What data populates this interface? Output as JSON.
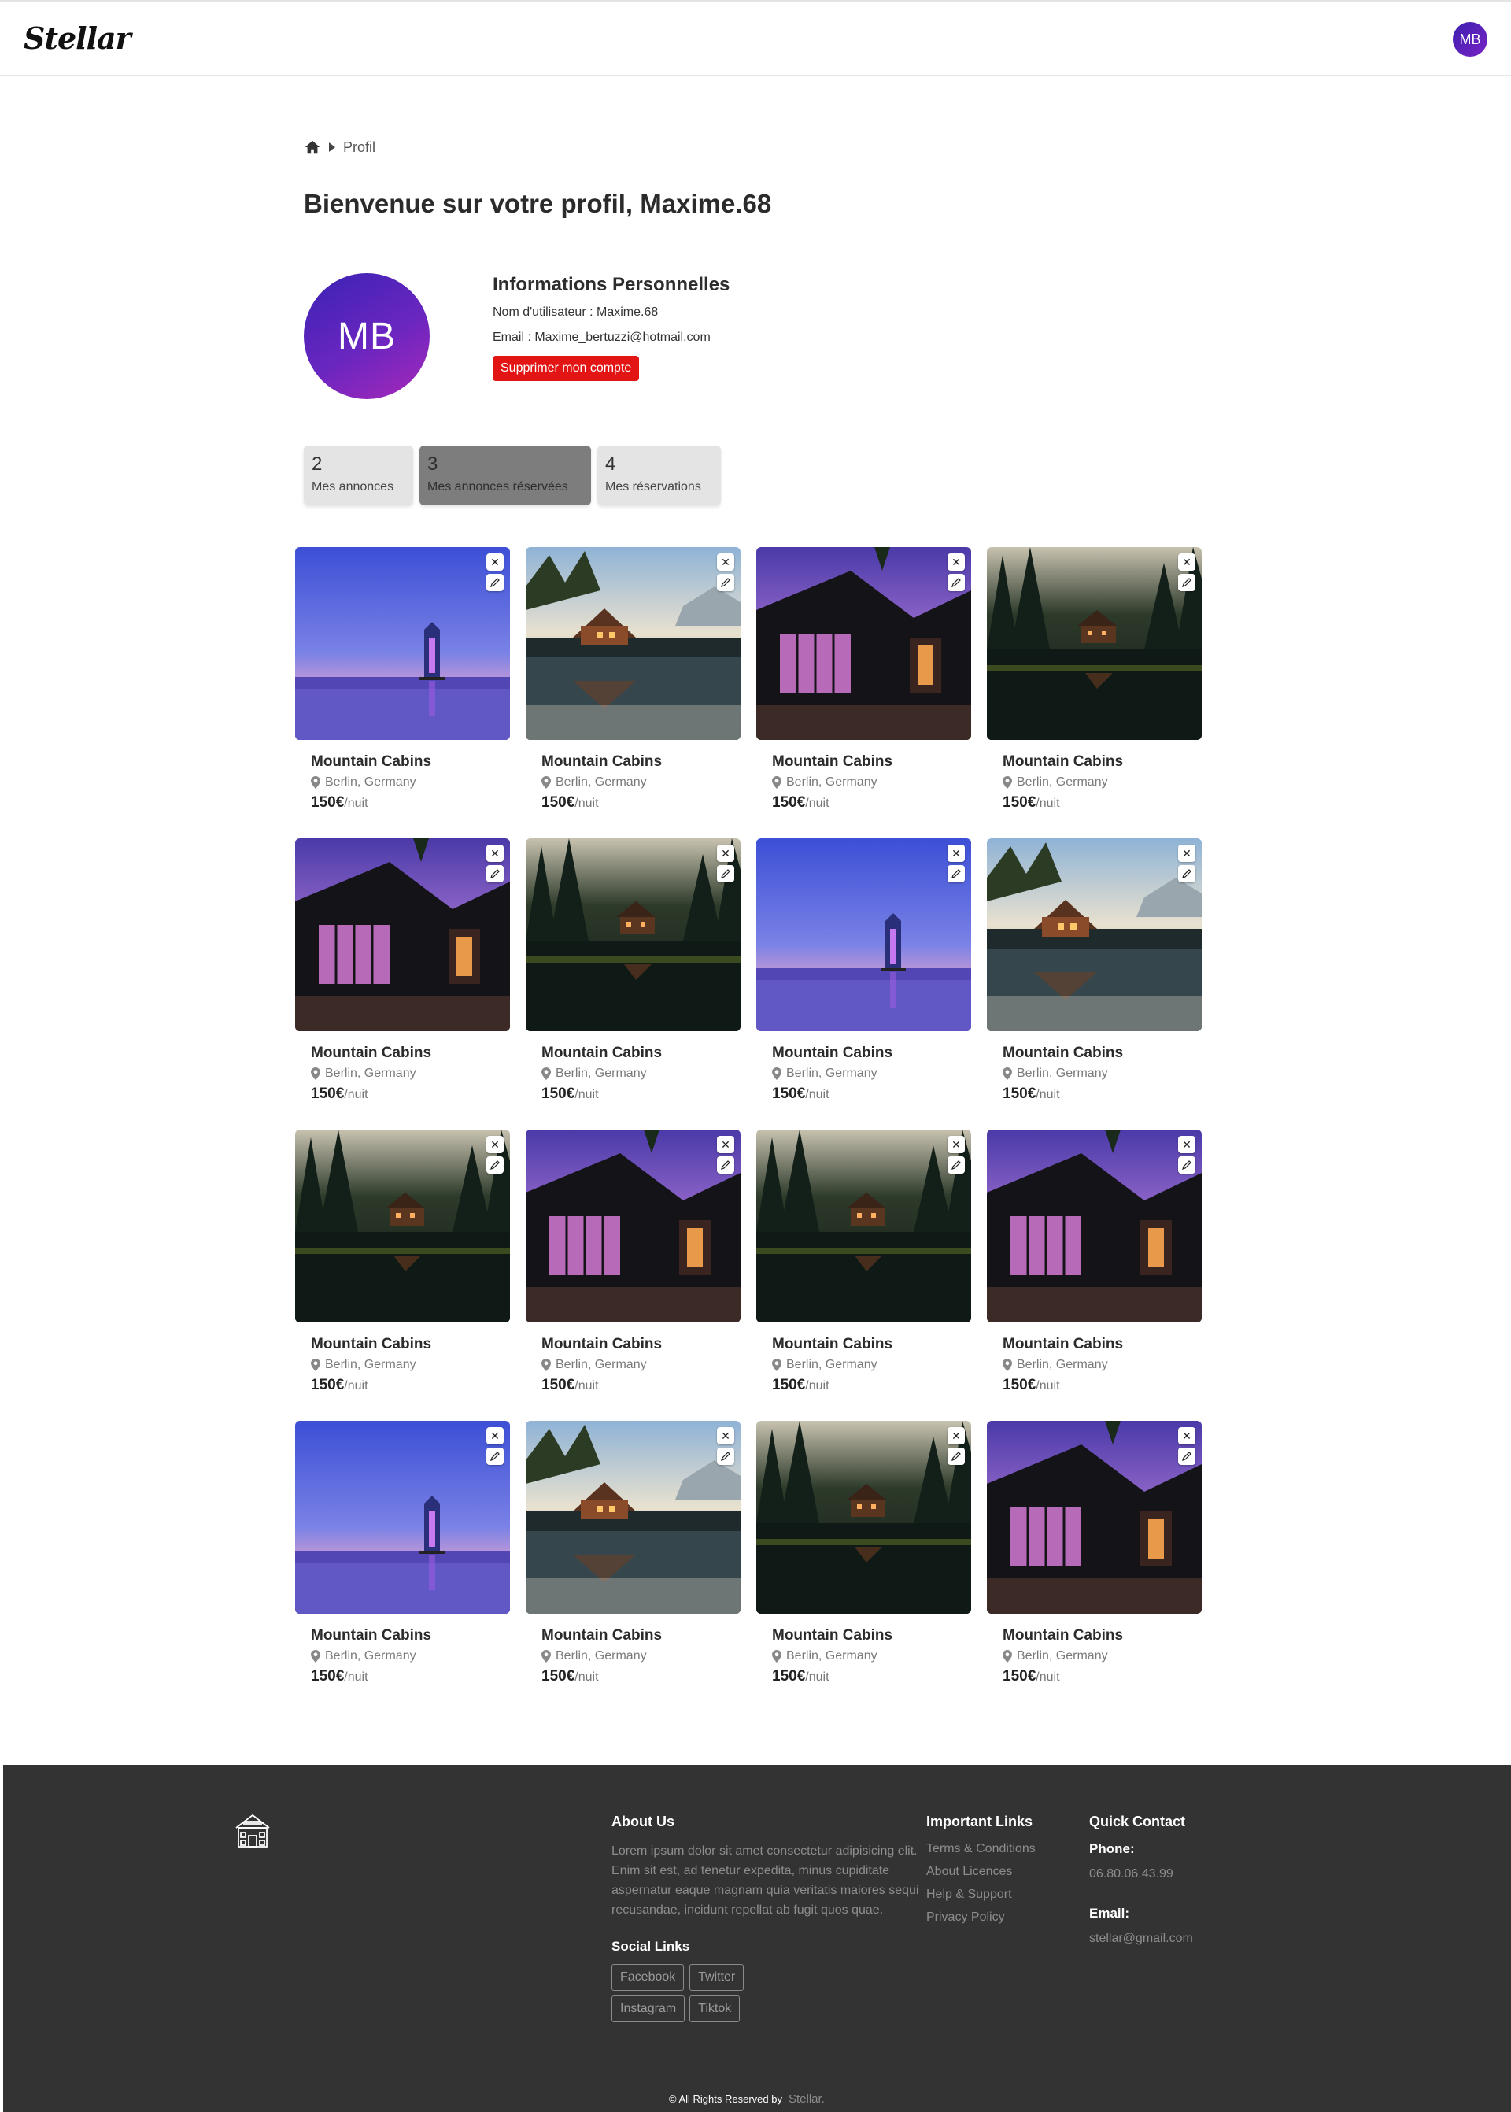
{
  "header": {
    "logo": "Stellar",
    "avatar_initials": "MB"
  },
  "breadcrumb": {
    "current": "Profil"
  },
  "page_title": "Bienvenue sur votre profil, Maxime.68",
  "profile": {
    "initials": "MB",
    "section_title": "Informations Personnelles",
    "username_line": "Nom d'utilisateur : Maxime.68",
    "email_line": "Email : Maxime_bertuzzi@hotmail.com",
    "delete_label": "Supprimer mon compte"
  },
  "stats": [
    {
      "count": "2",
      "label": "Mes annonces",
      "active": false
    },
    {
      "count": "3",
      "label": "Mes annonces réservées",
      "active": true
    },
    {
      "count": "4",
      "label": "Mes réservations",
      "active": false
    }
  ],
  "listing_actions": {
    "close_icon": "✕",
    "edit_icon": "pencil-icon"
  },
  "listings": [
    {
      "title": "Mountain Cabins",
      "location": "Berlin, Germany",
      "price": "150€",
      "unit": "/nuit",
      "image": "lantern-sea"
    },
    {
      "title": "Mountain Cabins",
      "location": "Berlin, Germany",
      "price": "150€",
      "unit": "/nuit",
      "image": "cabin-lake-day"
    },
    {
      "title": "Mountain Cabins",
      "location": "Berlin, Germany",
      "price": "150€",
      "unit": "/nuit",
      "image": "modern-house"
    },
    {
      "title": "Mountain Cabins",
      "location": "Berlin, Germany",
      "price": "150€",
      "unit": "/nuit",
      "image": "forest-cabin"
    },
    {
      "title": "Mountain Cabins",
      "location": "Berlin, Germany",
      "price": "150€",
      "unit": "/nuit",
      "image": "modern-house"
    },
    {
      "title": "Mountain Cabins",
      "location": "Berlin, Germany",
      "price": "150€",
      "unit": "/nuit",
      "image": "forest-cabin"
    },
    {
      "title": "Mountain Cabins",
      "location": "Berlin, Germany",
      "price": "150€",
      "unit": "/nuit",
      "image": "lantern-sea"
    },
    {
      "title": "Mountain Cabins",
      "location": "Berlin, Germany",
      "price": "150€",
      "unit": "/nuit",
      "image": "cabin-lake-day"
    },
    {
      "title": "Mountain Cabins",
      "location": "Berlin, Germany",
      "price": "150€",
      "unit": "/nuit",
      "image": "forest-cabin"
    },
    {
      "title": "Mountain Cabins",
      "location": "Berlin, Germany",
      "price": "150€",
      "unit": "/nuit",
      "image": "modern-house"
    },
    {
      "title": "Mountain Cabins",
      "location": "Berlin, Germany",
      "price": "150€",
      "unit": "/nuit",
      "image": "forest-cabin"
    },
    {
      "title": "Mountain Cabins",
      "location": "Berlin, Germany",
      "price": "150€",
      "unit": "/nuit",
      "image": "modern-house"
    },
    {
      "title": "Mountain Cabins",
      "location": "Berlin, Germany",
      "price": "150€",
      "unit": "/nuit",
      "image": "lantern-sea"
    },
    {
      "title": "Mountain Cabins",
      "location": "Berlin, Germany",
      "price": "150€",
      "unit": "/nuit",
      "image": "cabin-lake-day"
    },
    {
      "title": "Mountain Cabins",
      "location": "Berlin, Germany",
      "price": "150€",
      "unit": "/nuit",
      "image": "forest-cabin"
    },
    {
      "title": "Mountain Cabins",
      "location": "Berlin, Germany",
      "price": "150€",
      "unit": "/nuit",
      "image": "modern-house"
    }
  ],
  "footer": {
    "about_title": "About Us",
    "about_text": "Lorem ipsum dolor sit amet consectetur adipisicing elit. Enim sit est, ad tenetur expedita, minus cupiditate aspernatur eaque magnam quia veritatis maiores sequi recusandae, incidunt repellat ab fugit quos quae.",
    "social_title": "Social Links",
    "socials": [
      "Facebook",
      "Twitter",
      "Instagram",
      "Tiktok"
    ],
    "links_title": "Important Links",
    "links": [
      "Terms & Conditions",
      "About Licences",
      "Help & Support",
      "Privacy Policy"
    ],
    "contact_title": "Quick Contact",
    "phone_label": "Phone:",
    "phone": "06.80.06.43.99",
    "email_label": "Email:",
    "email": "stellar@gmail.com",
    "copyright": "© All Rights Reserved by",
    "brand": "Stellar."
  },
  "colors": {
    "accent": "#e21414",
    "avatar_from": "#3a22b4",
    "avatar_to": "#a828b8",
    "footer_bg": "#333333"
  }
}
